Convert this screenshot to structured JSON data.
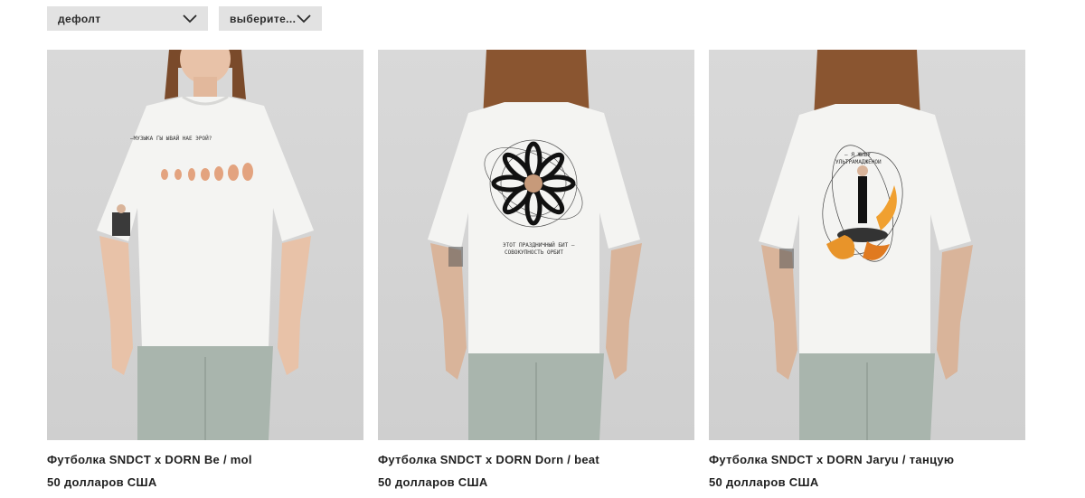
{
  "filters": {
    "sort": {
      "label": "дефолт",
      "icon": "chevron-down-icon"
    },
    "select": {
      "label": "выберите...",
      "icon": "chevron-down-icon"
    }
  },
  "products": [
    {
      "title": "Футболка SNDCT x DORN Be / mol",
      "price": "50 долларов США",
      "print_text": "—МУЗЫКА ГЫ ЫВАЙ НАЕ ЭРОЙ?"
    },
    {
      "title": "Футболка SNDCT x DORN Dorn / beat",
      "price": "50 долларов США",
      "print_text_1": "ЭТОТ ПРАЗДНИЧНЫЙ БИТ —",
      "print_text_2": "СОВОКУПНОСТЬ ОРБИТ"
    },
    {
      "title": "Футболка SNDCT x DORN Jaryu / танцую",
      "price": "50 долларов США",
      "print_text_1": "— Я ЖИВУ",
      "print_text_2": "УЛЬТРАМАДЖЕНОИ"
    }
  ],
  "colors": {
    "filter_bg": "#e2e2e2",
    "photo_bg": "#d4d4d4",
    "shirt": "#f4f4f2",
    "pants": "#a9b5ad",
    "hair": "#7a4a2a",
    "text": "#1f1f1f"
  }
}
